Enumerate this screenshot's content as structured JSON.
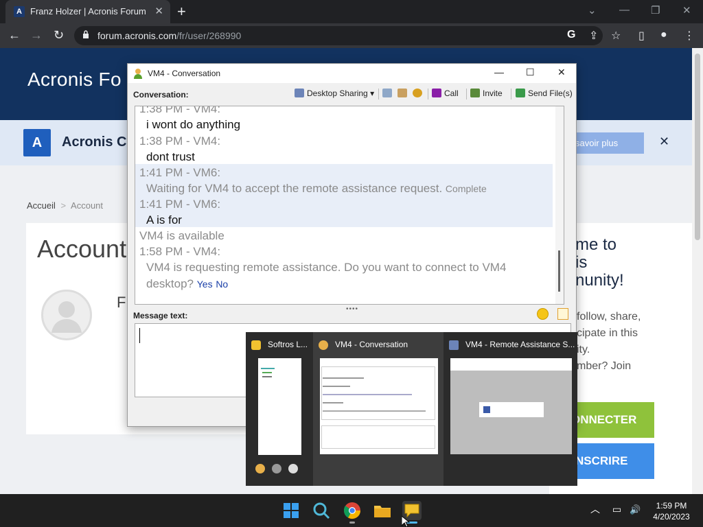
{
  "browser": {
    "tab_title": "Franz Holzer | Acronis Forum",
    "tab_favicon_letter": "A",
    "url_domain": "forum.acronis.com",
    "url_path": "/fr/user/268990"
  },
  "site": {
    "logo_text": "Acronis Fo",
    "banner_logo_letter": "A",
    "banner_text": "Acronis Cy",
    "banner_button": "savoir plus",
    "breadcrumb_home": "Accueil",
    "breadcrumb_sep": ">",
    "breadcrumb_current": "Account",
    "card_title": "Account",
    "card_partial_name": "Fr",
    "welcome_lines": [
      "me to",
      "is",
      "nunity!"
    ],
    "welcome_text_lines": [
      "follow, share,",
      "cipate in this",
      "ity.",
      "mber? Join"
    ],
    "connect_button": "ONNECTER",
    "signup_button": "NSCRIRE"
  },
  "conversation": {
    "window_title": "VM4 - Conversation",
    "conversation_label": "Conversation:",
    "toolbar": {
      "desktop_sharing": "Desktop Sharing",
      "call": "Call",
      "invite": "Invite",
      "send_files": "Send File(s)"
    },
    "messages": [
      {
        "header": "1:38 PM - VM4:",
        "text": "i wont do anything"
      },
      {
        "header": "1:38 PM - VM4:",
        "text": "dont trust"
      },
      {
        "header": "1:41 PM - VM6:",
        "text": "Waiting for VM4 to accept the remote assistance request.",
        "status": "Complete"
      },
      {
        "header": "1:41 PM - VM6:",
        "text": "A is for"
      },
      {
        "header": "VM4 is available"
      },
      {
        "header": "1:58 PM - VM4:",
        "text_line1": "VM4 is requesting remote assistance. Do you want to connect to VM4",
        "text_line2": "desktop?",
        "yes": "Yes",
        "no": "No"
      }
    ],
    "splitter": "••••",
    "message_label": "Message text:",
    "message_value": ""
  },
  "previews": [
    {
      "label": "Softros L..."
    },
    {
      "label": "VM4 - Conversation"
    },
    {
      "label": "VM4 - Remote Assistance S..."
    }
  ],
  "taskbar": {
    "time": "1:59 PM",
    "date": "4/20/2023"
  },
  "icons": {
    "browser_close": "✕",
    "new_tab": "+",
    "back": "←",
    "forward": "→",
    "reload": "↻",
    "chevron": "⌄",
    "minimize": "—",
    "restore": "❐",
    "maximize": "☐",
    "close": "✕",
    "star": "☆",
    "share": "⇪",
    "menu": "⋮",
    "profile": "●",
    "sidebar": "▯",
    "google": "G",
    "banner_close": "✕",
    "tray_up": "︿",
    "tray_network": "▭",
    "tray_volume": "🔊",
    "dropdown": "▾"
  }
}
